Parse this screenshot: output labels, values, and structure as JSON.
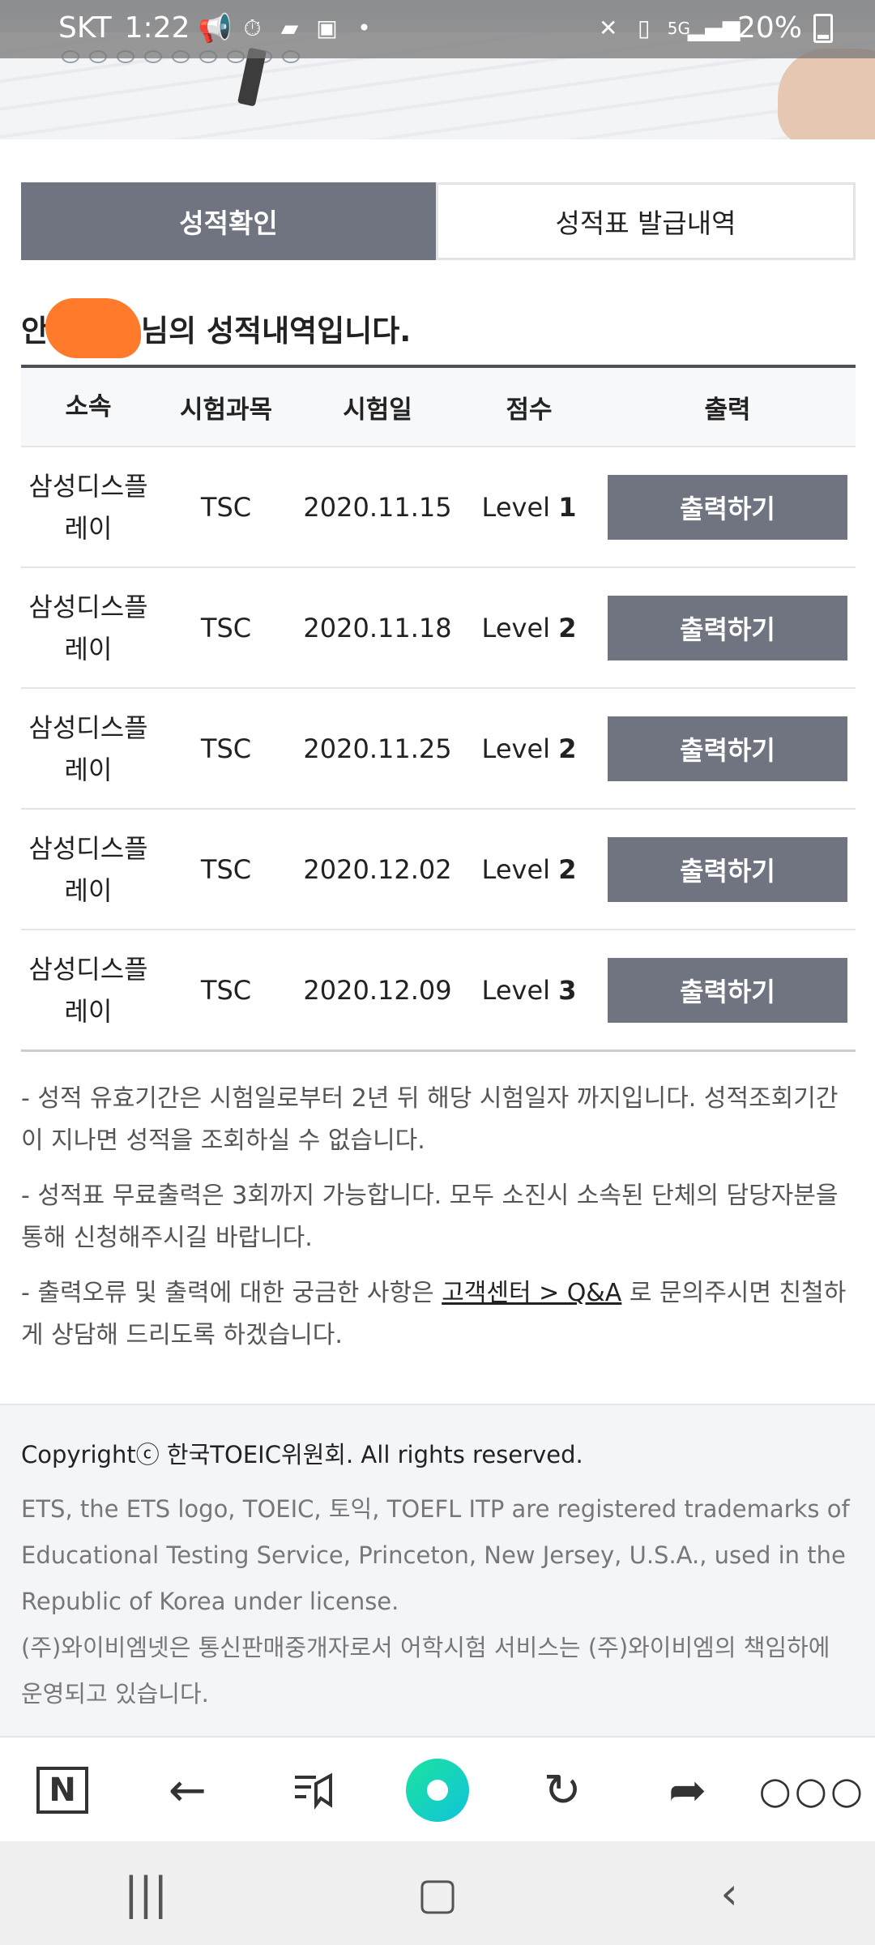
{
  "status_bar": {
    "carrier": "SKT",
    "time": "1:22",
    "network": "5G",
    "battery": "20%"
  },
  "tabs": [
    {
      "label": "성적확인",
      "active": true
    },
    {
      "label": "성적표 발급내역",
      "active": false
    }
  ],
  "heading": {
    "prefix": "안",
    "suffix": "님의 성적내역입니다."
  },
  "table": {
    "headers": [
      "소속",
      "시험과목",
      "시험일",
      "점수",
      "출력"
    ],
    "rows": [
      {
        "org_line1": "삼성디스플",
        "org_line2": "레이",
        "subject": "TSC",
        "date": "2020.11.15",
        "level_label": "Level",
        "level": "1",
        "action": "출력하기"
      },
      {
        "org_line1": "삼성디스플",
        "org_line2": "레이",
        "subject": "TSC",
        "date": "2020.11.18",
        "level_label": "Level",
        "level": "2",
        "action": "출력하기"
      },
      {
        "org_line1": "삼성디스플",
        "org_line2": "레이",
        "subject": "TSC",
        "date": "2020.11.25",
        "level_label": "Level",
        "level": "2",
        "action": "출력하기"
      },
      {
        "org_line1": "삼성디스플",
        "org_line2": "레이",
        "subject": "TSC",
        "date": "2020.12.02",
        "level_label": "Level",
        "level": "2",
        "action": "출력하기"
      },
      {
        "org_line1": "삼성디스플",
        "org_line2": "레이",
        "subject": "TSC",
        "date": "2020.12.09",
        "level_label": "Level",
        "level": "3",
        "action": "출력하기"
      }
    ]
  },
  "notes": {
    "note1": "- 성적 유효기간은 시험일로부터 2년 뒤 해당 시험일자 까지입니다. 성적조회기간이 지나면 성적을 조회하실 수 없습니다.",
    "note2": "- 성적표 무료출력은 3회까지 가능합니다. 모두 소진시 소속된 단체의 담당자분을 통해 신청해주시길 바랍니다.",
    "note3_prefix": "- 출력오류 및 출력에 대한 궁금한 사항은 ",
    "note3_link": "고객센터 > Q&A",
    "note3_suffix": " 로 문의주시면 친철하게 상담해 드리도록 하겠습니다."
  },
  "footer": {
    "copyright": "Copyrightⓒ 한국TOEIC위원회. All rights reserved.",
    "legal1": "ETS, the ETS logo, TOEIC, 토익, TOEFL ITP are registered trademarks of Educational Testing Service, Princeton, New Jersey, U.S.A., used in the Republic of Korea under license.",
    "legal2": "(주)와이비엠넷은 통신판매중개자로서 어학시험 서비스는 (주)와이비엠의 책임하에 운영되고 있습니다."
  },
  "browser_bar": {
    "home_label": "N"
  },
  "colors": {
    "active_tab": "#6f7480",
    "button": "#6f7480",
    "redaction": "#ff7a2a",
    "green_button": "#1be3a0"
  },
  "icons": [
    "megaphone-icon",
    "timer-icon",
    "chat-icon",
    "shopping-bag-icon",
    "mute-icon",
    "battery-saver-icon",
    "signal-icon",
    "battery-icon",
    "naver-home-icon",
    "back-arrow-icon",
    "bookmark-icon",
    "green-dot-icon",
    "refresh-icon",
    "share-icon",
    "more-icon",
    "recent-apps-icon",
    "home-icon",
    "system-back-icon"
  ]
}
